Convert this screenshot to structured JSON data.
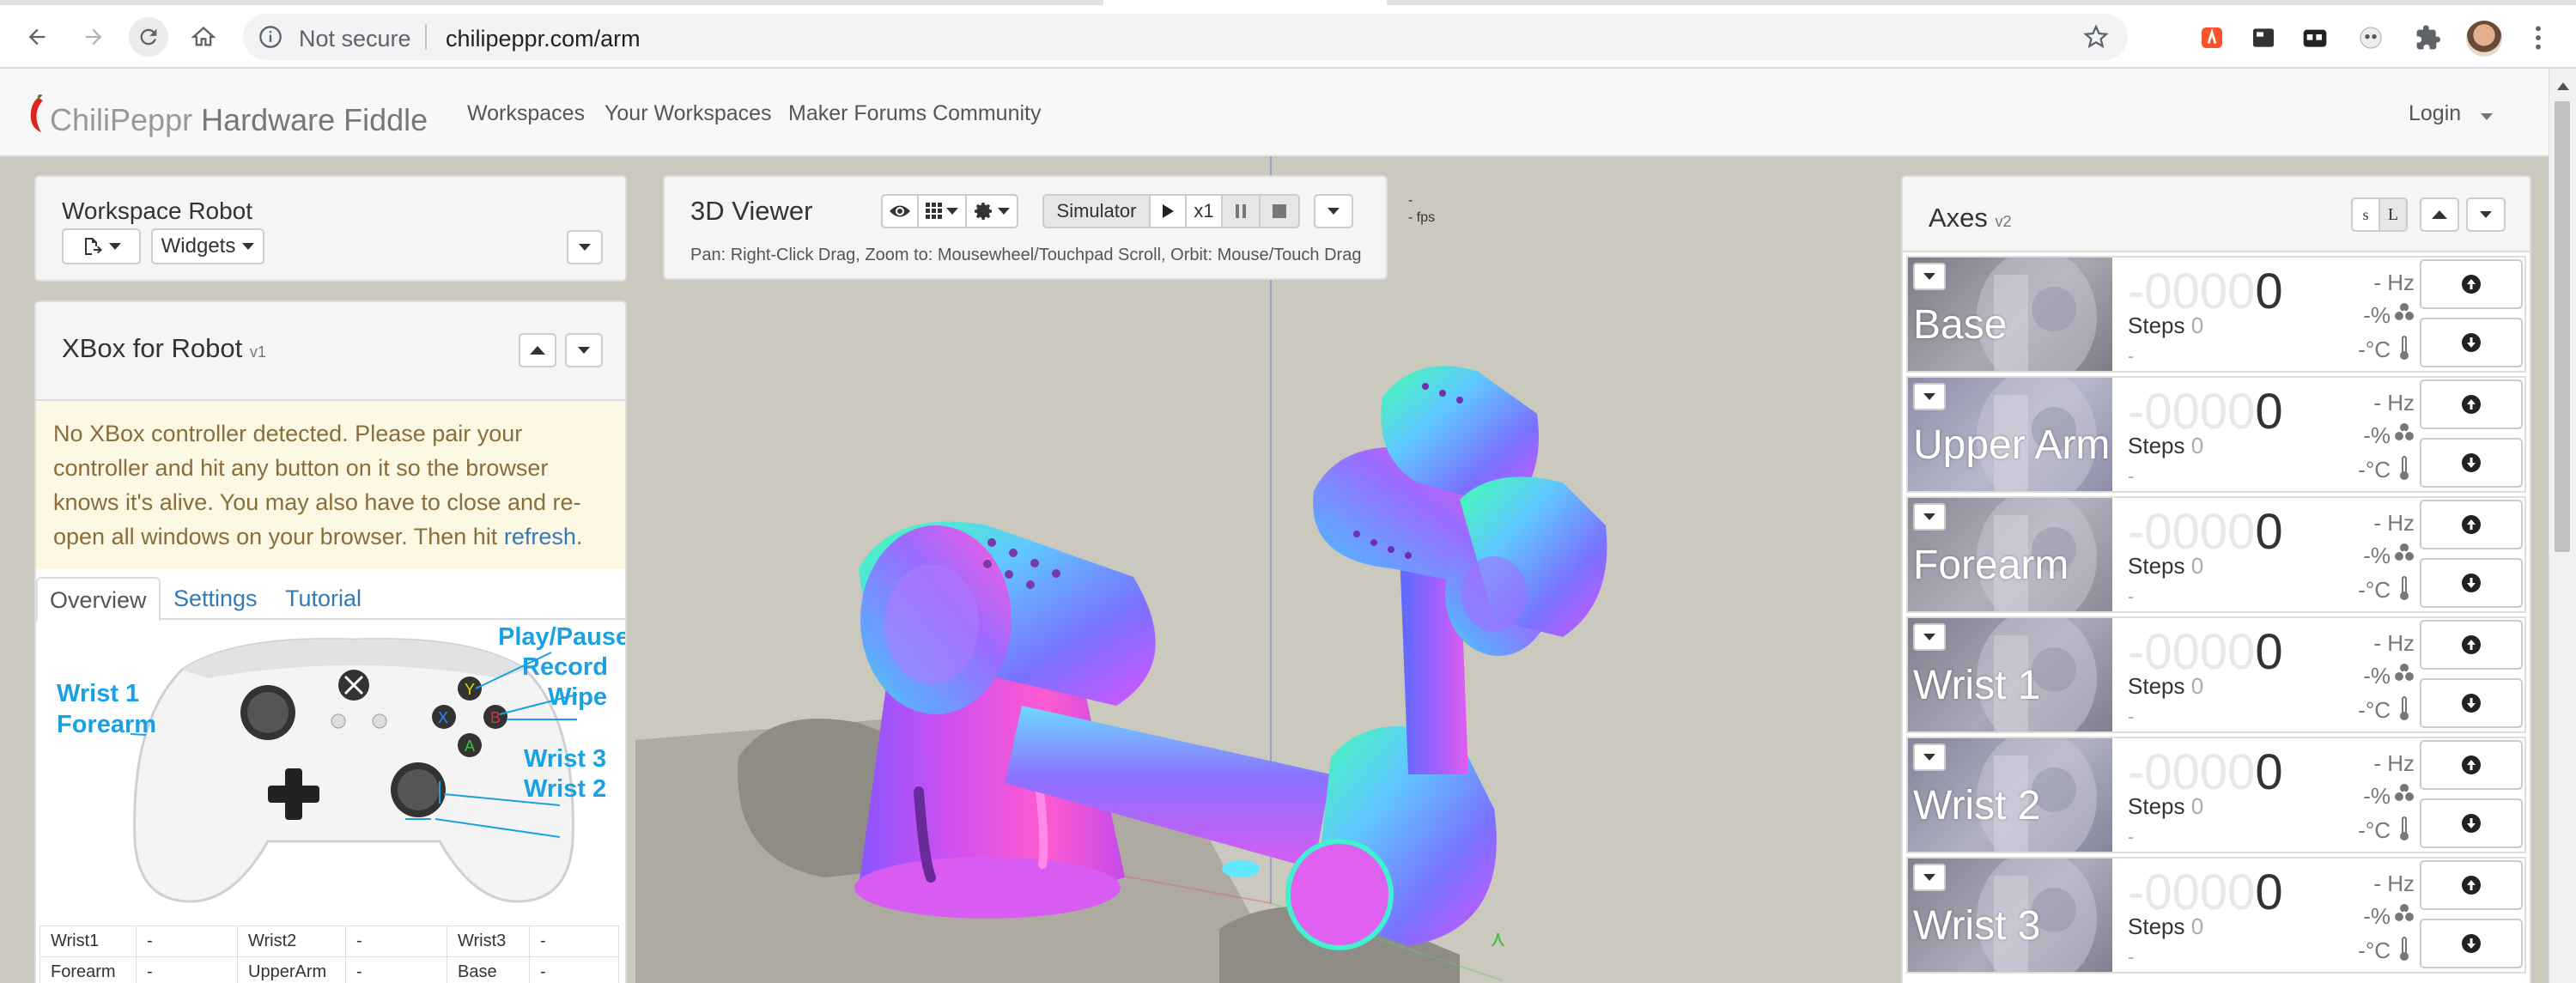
{
  "browser": {
    "security_label": "Not secure",
    "url": "chilipeppr.com/arm"
  },
  "navbar": {
    "brand_first": "ChiliPeppr",
    "brand_second": "Hardware Fiddle",
    "links": [
      "Workspaces",
      "Your Workspaces",
      "Maker Forums Community"
    ],
    "login": "Login"
  },
  "workspace": {
    "title": "Workspace Robot",
    "widgets_label": "Widgets"
  },
  "xbox": {
    "title": "XBox for Robot",
    "version": "v1",
    "alert_text": "No XBox controller detected. Please pair your controller and hit any button on it so the browser knows it's alive. You may also have to close and re-open all windows on your browser. Then hit",
    "alert_link": "refresh",
    "alert_end": ".",
    "tabs": [
      "Overview",
      "Settings",
      "Tutorial"
    ],
    "controller_labels": {
      "play_pause": "Play/Pause",
      "record": "Record",
      "wipe": "Wipe",
      "wrist1": "Wrist 1",
      "forearm": "Forearm",
      "wrist3": "Wrist 3",
      "wrist2": "Wrist 2"
    },
    "button_letters": {
      "y": "Y",
      "x": "X",
      "b": "B",
      "a": "A"
    },
    "table": [
      [
        "Wrist1",
        "-",
        "Wrist2",
        "-",
        "Wrist3",
        "-"
      ],
      [
        "Forearm",
        "-",
        "UpperArm",
        "-",
        "Base",
        "-"
      ]
    ]
  },
  "viewer": {
    "title": "3D Viewer",
    "simulator_label": "Simulator",
    "speed_label": "x1",
    "help_text": "Pan: Right-Click Drag, Zoom to: Mousewheel/Touchpad Scroll, Orbit: Mouse/Touch Drag",
    "fps_value": "-",
    "fps_label": "- fps"
  },
  "axes": {
    "title": "Axes",
    "version": "v2",
    "size_small": "s",
    "size_large": "L",
    "rows": [
      {
        "name": "Base",
        "pos_ghost": "-0000",
        "pos_value": "0",
        "steps_label": "Steps",
        "steps_value": "0",
        "extra": "-",
        "hz": "- Hz",
        "pct": "-%",
        "temp": "-°C"
      },
      {
        "name": "Upper Arm",
        "pos_ghost": "-0000",
        "pos_value": "0",
        "steps_label": "Steps",
        "steps_value": "0",
        "extra": "-",
        "hz": "- Hz",
        "pct": "-%",
        "temp": "-°C"
      },
      {
        "name": "Forearm",
        "pos_ghost": "-0000",
        "pos_value": "0",
        "steps_label": "Steps",
        "steps_value": "0",
        "extra": "-",
        "hz": "- Hz",
        "pct": "-%",
        "temp": "-°C"
      },
      {
        "name": "Wrist 1",
        "pos_ghost": "-0000",
        "pos_value": "0",
        "steps_label": "Steps",
        "steps_value": "0",
        "extra": "-",
        "hz": "- Hz",
        "pct": "-%",
        "temp": "-°C"
      },
      {
        "name": "Wrist 2",
        "pos_ghost": "-0000",
        "pos_value": "0",
        "steps_label": "Steps",
        "steps_value": "0",
        "extra": "-",
        "hz": "- Hz",
        "pct": "-%",
        "temp": "-°C"
      },
      {
        "name": "Wrist 3",
        "pos_ghost": "-0000",
        "pos_value": "0",
        "steps_label": "Steps",
        "steps_value": "0",
        "extra": "-",
        "hz": "- Hz",
        "pct": "-%",
        "temp": "-°C"
      }
    ]
  },
  "colors": {
    "link": "#337ab7",
    "controller_label": "#1ba1e2",
    "alert_bg": "#fcf8e3",
    "scene_floor": "#cbc8bd"
  }
}
